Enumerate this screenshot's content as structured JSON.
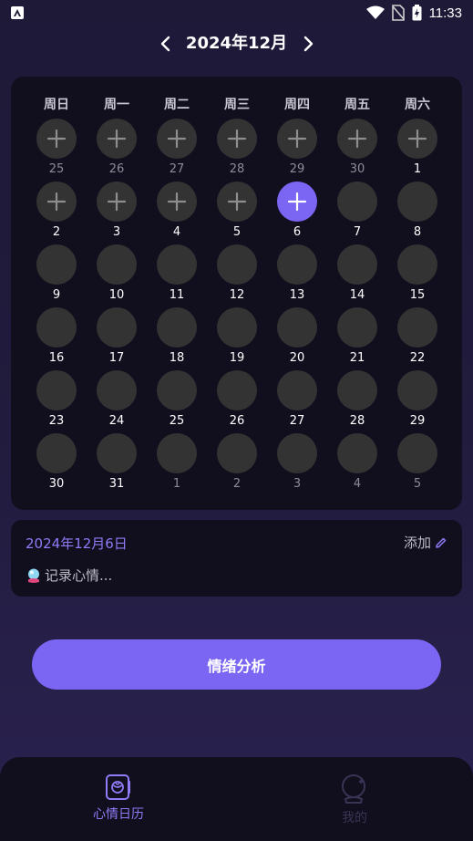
{
  "status_bar": {
    "time": "11:33"
  },
  "header": {
    "month_title": "2024年12月"
  },
  "calendar": {
    "weekdays": [
      "周日",
      "周一",
      "周二",
      "周三",
      "周四",
      "周五",
      "周六"
    ],
    "days": [
      {
        "num": "25",
        "other": true,
        "state": "plus"
      },
      {
        "num": "26",
        "other": true,
        "state": "plus"
      },
      {
        "num": "27",
        "other": true,
        "state": "plus"
      },
      {
        "num": "28",
        "other": true,
        "state": "plus"
      },
      {
        "num": "29",
        "other": true,
        "state": "plus"
      },
      {
        "num": "30",
        "other": true,
        "state": "plus"
      },
      {
        "num": "1",
        "other": false,
        "state": "plus"
      },
      {
        "num": "2",
        "other": false,
        "state": "plus"
      },
      {
        "num": "3",
        "other": false,
        "state": "plus"
      },
      {
        "num": "4",
        "other": false,
        "state": "plus"
      },
      {
        "num": "5",
        "other": false,
        "state": "plus"
      },
      {
        "num": "6",
        "other": false,
        "state": "selected"
      },
      {
        "num": "7",
        "other": false,
        "state": "empty"
      },
      {
        "num": "8",
        "other": false,
        "state": "empty"
      },
      {
        "num": "9",
        "other": false,
        "state": "empty"
      },
      {
        "num": "10",
        "other": false,
        "state": "empty"
      },
      {
        "num": "11",
        "other": false,
        "state": "empty"
      },
      {
        "num": "12",
        "other": false,
        "state": "empty"
      },
      {
        "num": "13",
        "other": false,
        "state": "empty"
      },
      {
        "num": "14",
        "other": false,
        "state": "empty"
      },
      {
        "num": "15",
        "other": false,
        "state": "empty"
      },
      {
        "num": "16",
        "other": false,
        "state": "empty"
      },
      {
        "num": "17",
        "other": false,
        "state": "empty"
      },
      {
        "num": "18",
        "other": false,
        "state": "empty"
      },
      {
        "num": "19",
        "other": false,
        "state": "empty"
      },
      {
        "num": "20",
        "other": false,
        "state": "empty"
      },
      {
        "num": "21",
        "other": false,
        "state": "empty"
      },
      {
        "num": "22",
        "other": false,
        "state": "empty"
      },
      {
        "num": "23",
        "other": false,
        "state": "empty"
      },
      {
        "num": "24",
        "other": false,
        "state": "empty"
      },
      {
        "num": "25",
        "other": false,
        "state": "empty"
      },
      {
        "num": "26",
        "other": false,
        "state": "empty"
      },
      {
        "num": "27",
        "other": false,
        "state": "empty"
      },
      {
        "num": "28",
        "other": false,
        "state": "empty"
      },
      {
        "num": "29",
        "other": false,
        "state": "empty"
      },
      {
        "num": "30",
        "other": false,
        "state": "empty"
      },
      {
        "num": "31",
        "other": false,
        "state": "empty"
      },
      {
        "num": "1",
        "other": true,
        "state": "empty"
      },
      {
        "num": "2",
        "other": true,
        "state": "empty"
      },
      {
        "num": "3",
        "other": true,
        "state": "empty"
      },
      {
        "num": "4",
        "other": true,
        "state": "empty"
      },
      {
        "num": "5",
        "other": true,
        "state": "empty"
      }
    ]
  },
  "note": {
    "selected_date": "2024年12月6日",
    "add_label": "添加",
    "placeholder": "记录心情..."
  },
  "analysis_button": {
    "label": "情绪分析"
  },
  "bottom_nav": {
    "items": [
      {
        "label": "心情日历",
        "active": true,
        "icon": "mood-calendar-icon"
      },
      {
        "label": "我的",
        "active": false,
        "icon": "crystal-ball-icon"
      }
    ]
  },
  "colors": {
    "accent": "#7a66f2",
    "accent_text": "#8f7cf6",
    "card_bg": "#110e1e",
    "circle_bg": "#333333"
  }
}
